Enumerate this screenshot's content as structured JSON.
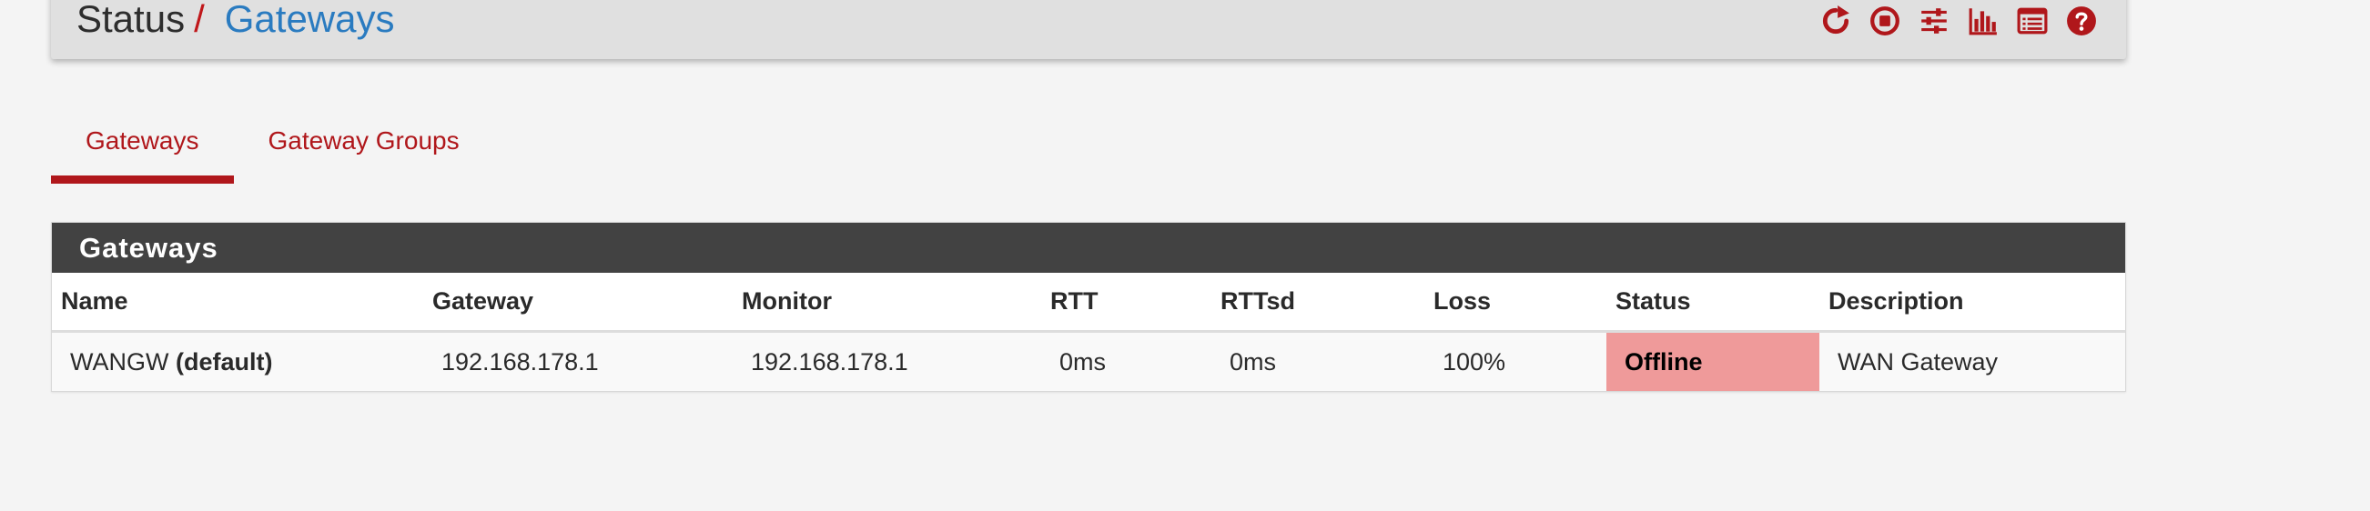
{
  "header": {
    "breadcrumb_root": "Status",
    "breadcrumb_separator": "/",
    "breadcrumb_current": "Gateways",
    "icons": [
      "reload-icon",
      "stop-icon",
      "sliders-icon",
      "bar-chart-icon",
      "list-icon",
      "help-icon"
    ]
  },
  "tabs": [
    {
      "label": "Gateways",
      "active": true
    },
    {
      "label": "Gateway Groups",
      "active": false
    }
  ],
  "panel": {
    "title": "Gateways",
    "columns": [
      "Name",
      "Gateway",
      "Monitor",
      "RTT",
      "RTTsd",
      "Loss",
      "Status",
      "Description"
    ],
    "rows": [
      {
        "name": "WANGW",
        "name_suffix": "(default)",
        "gateway": "192.168.178.1",
        "monitor": "192.168.178.1",
        "rtt": "0ms",
        "rttsd": "0ms",
        "loss": "100%",
        "status": "Offline",
        "description": "WAN Gateway"
      }
    ]
  },
  "colors": {
    "accent_red": "#b0171b",
    "link_blue": "#2a7bc0",
    "panel_heading_bg": "#424242",
    "status_offline_bg": "#ef9a9a",
    "page_bg": "#f4f4f4"
  }
}
